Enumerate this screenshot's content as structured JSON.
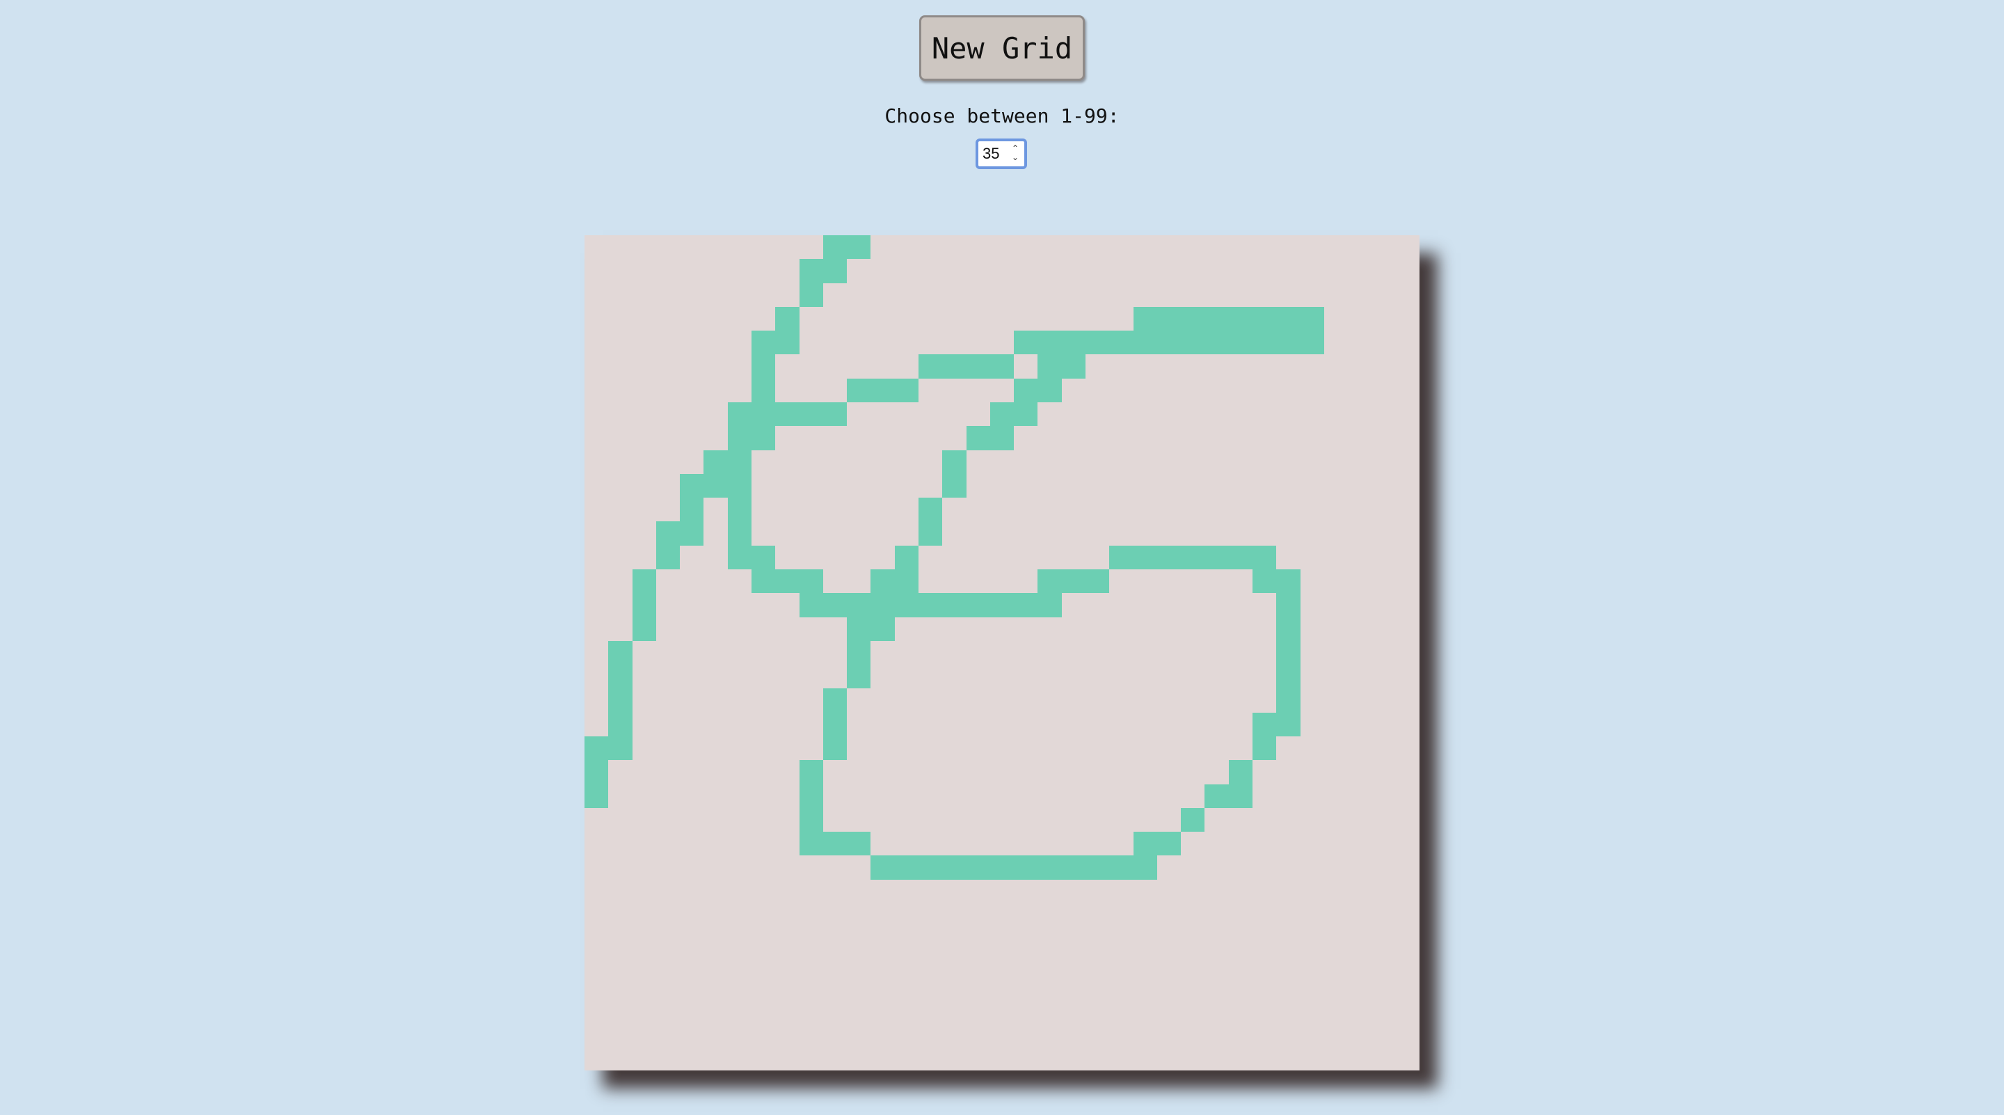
{
  "toolbar": {
    "new_grid_label": "New Grid"
  },
  "size_control": {
    "label": "Choose between 1-99:",
    "value": "35"
  },
  "grid": {
    "size": 35,
    "background_color": "#e2d8d7",
    "painted_color": "#6ccfb3",
    "painted_cells": [
      [
        0,
        10
      ],
      [
        0,
        11
      ],
      [
        1,
        9
      ],
      [
        1,
        10
      ],
      [
        2,
        9
      ],
      [
        3,
        8
      ],
      [
        3,
        23
      ],
      [
        3,
        24
      ],
      [
        3,
        25
      ],
      [
        3,
        26
      ],
      [
        3,
        27
      ],
      [
        3,
        28
      ],
      [
        3,
        29
      ],
      [
        3,
        30
      ],
      [
        4,
        7
      ],
      [
        4,
        8
      ],
      [
        4,
        18
      ],
      [
        4,
        19
      ],
      [
        4,
        20
      ],
      [
        4,
        21
      ],
      [
        4,
        22
      ],
      [
        4,
        23
      ],
      [
        4,
        24
      ],
      [
        4,
        25
      ],
      [
        4,
        26
      ],
      [
        4,
        27
      ],
      [
        4,
        28
      ],
      [
        4,
        29
      ],
      [
        4,
        30
      ],
      [
        5,
        7
      ],
      [
        5,
        14
      ],
      [
        5,
        15
      ],
      [
        5,
        16
      ],
      [
        5,
        17
      ],
      [
        5,
        19
      ],
      [
        5,
        20
      ],
      [
        6,
        7
      ],
      [
        6,
        11
      ],
      [
        6,
        12
      ],
      [
        6,
        13
      ],
      [
        6,
        18
      ],
      [
        6,
        19
      ],
      [
        7,
        6
      ],
      [
        7,
        7
      ],
      [
        7,
        8
      ],
      [
        7,
        9
      ],
      [
        7,
        10
      ],
      [
        7,
        17
      ],
      [
        7,
        18
      ],
      [
        8,
        6
      ],
      [
        8,
        7
      ],
      [
        8,
        16
      ],
      [
        8,
        17
      ],
      [
        9,
        5
      ],
      [
        9,
        6
      ],
      [
        9,
        15
      ],
      [
        10,
        4
      ],
      [
        10,
        5
      ],
      [
        10,
        6
      ],
      [
        10,
        15
      ],
      [
        11,
        4
      ],
      [
        11,
        6
      ],
      [
        11,
        14
      ],
      [
        12,
        3
      ],
      [
        12,
        4
      ],
      [
        12,
        6
      ],
      [
        12,
        14
      ],
      [
        13,
        3
      ],
      [
        13,
        6
      ],
      [
        13,
        7
      ],
      [
        13,
        13
      ],
      [
        13,
        22
      ],
      [
        13,
        23
      ],
      [
        13,
        24
      ],
      [
        13,
        25
      ],
      [
        13,
        26
      ],
      [
        13,
        27
      ],
      [
        13,
        28
      ],
      [
        14,
        2
      ],
      [
        14,
        7
      ],
      [
        14,
        8
      ],
      [
        14,
        9
      ],
      [
        14,
        12
      ],
      [
        14,
        13
      ],
      [
        14,
        19
      ],
      [
        14,
        20
      ],
      [
        14,
        21
      ],
      [
        14,
        28
      ],
      [
        14,
        29
      ],
      [
        15,
        2
      ],
      [
        15,
        9
      ],
      [
        15,
        10
      ],
      [
        15,
        11
      ],
      [
        15,
        12
      ],
      [
        15,
        13
      ],
      [
        15,
        14
      ],
      [
        15,
        15
      ],
      [
        15,
        16
      ],
      [
        15,
        17
      ],
      [
        15,
        18
      ],
      [
        15,
        19
      ],
      [
        15,
        29
      ],
      [
        16,
        2
      ],
      [
        16,
        11
      ],
      [
        16,
        12
      ],
      [
        16,
        29
      ],
      [
        17,
        1
      ],
      [
        17,
        11
      ],
      [
        17,
        29
      ],
      [
        18,
        1
      ],
      [
        18,
        11
      ],
      [
        18,
        29
      ],
      [
        19,
        1
      ],
      [
        19,
        10
      ],
      [
        19,
        29
      ],
      [
        20,
        1
      ],
      [
        20,
        10
      ],
      [
        20,
        28
      ],
      [
        20,
        29
      ],
      [
        21,
        0
      ],
      [
        21,
        1
      ],
      [
        21,
        10
      ],
      [
        21,
        28
      ],
      [
        22,
        0
      ],
      [
        22,
        9
      ],
      [
        22,
        27
      ],
      [
        23,
        0
      ],
      [
        23,
        9
      ],
      [
        23,
        26
      ],
      [
        23,
        27
      ],
      [
        24,
        9
      ],
      [
        24,
        25
      ],
      [
        25,
        9
      ],
      [
        25,
        10
      ],
      [
        25,
        11
      ],
      [
        25,
        23
      ],
      [
        25,
        24
      ],
      [
        26,
        12
      ],
      [
        26,
        13
      ],
      [
        26,
        14
      ],
      [
        26,
        15
      ],
      [
        26,
        16
      ],
      [
        26,
        17
      ],
      [
        26,
        18
      ],
      [
        26,
        19
      ],
      [
        26,
        20
      ],
      [
        26,
        21
      ],
      [
        26,
        22
      ],
      [
        26,
        23
      ]
    ]
  }
}
